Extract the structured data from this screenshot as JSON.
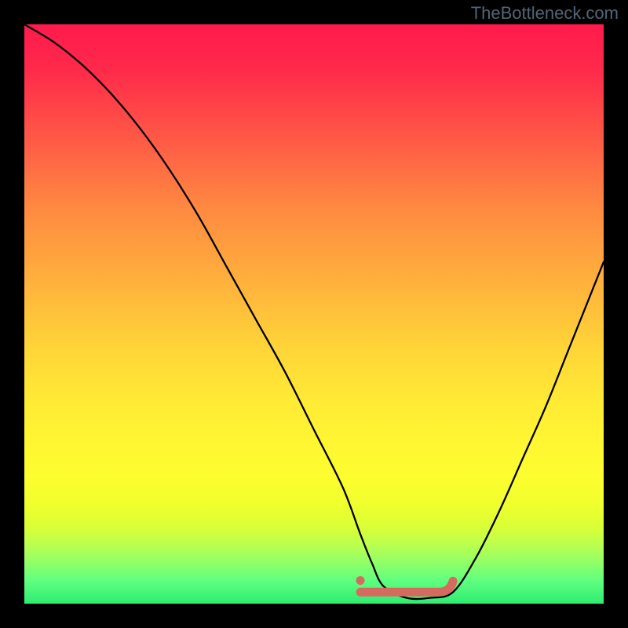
{
  "watermark": "TheBottleneck.com",
  "chart_data": {
    "type": "line",
    "title": "",
    "xlabel": "",
    "ylabel": "",
    "xlim": [
      0,
      100
    ],
    "ylim": [
      0,
      100
    ],
    "series": [
      {
        "name": "bottleneck-curve",
        "x": [
          0,
          5,
          10,
          15,
          20,
          25,
          30,
          35,
          40,
          45,
          50,
          55,
          58,
          60,
          62,
          66,
          70,
          74,
          78,
          82,
          86,
          90,
          94,
          98,
          100
        ],
        "y": [
          100,
          97,
          93,
          88,
          82,
          75,
          67,
          58,
          49,
          40,
          30,
          20,
          12,
          7,
          3,
          1,
          1,
          2,
          8,
          16,
          25,
          34,
          44,
          54,
          59
        ]
      }
    ],
    "annotations": [
      {
        "name": "optimal-range-marker",
        "x_start": 58,
        "x_end": 74,
        "y": 2,
        "color": "#d66a5f"
      },
      {
        "name": "optimal-point-dot",
        "x": 58,
        "y": 4,
        "color": "#d66a5f"
      }
    ],
    "gradient_stops": [
      {
        "pct": 0,
        "color": "#ff1a4d"
      },
      {
        "pct": 50,
        "color": "#ffd538"
      },
      {
        "pct": 100,
        "color": "#2eec71"
      }
    ]
  }
}
